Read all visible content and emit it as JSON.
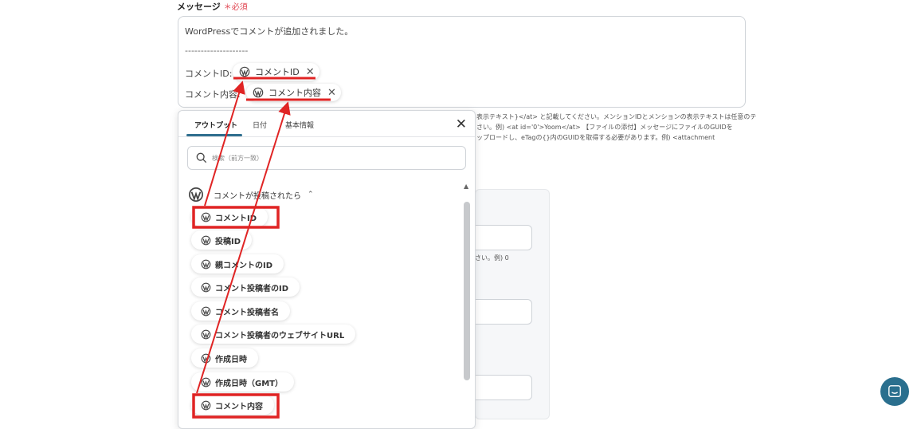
{
  "field": {
    "label": "メッセージ",
    "required": "＊必須"
  },
  "message": {
    "line1": "WordPressでコメントが追加されました。",
    "divider": "--------------------",
    "comment_id_label": "コメントID:",
    "comment_id_chip": "コメントID",
    "comment_content_label": "コメント内容:",
    "comment_content_chip": "コメント内容"
  },
  "help": {
    "line1": "表示テキスト}</at> と記載してください。メンションIDとメンションの表示テキストは任意のテ",
    "line2": "さい。例) <at id='0'>Yoom</at>  【ファイルの添付】メッセージにファイルのGUIDを",
    "line3": "ップロードし、eTagの{}内のGUIDを取得する必要があります。例) <attachment"
  },
  "background": {
    "hint": "さい。例) 0"
  },
  "popup": {
    "tabs": [
      "アウトプット",
      "日付",
      "基本情報"
    ],
    "search_placeholder": "検索（前方一致）",
    "group_label": "コメントが投稿されたら",
    "items": [
      "コメントID",
      "投稿ID",
      "親コメントのID",
      "コメント投稿者のID",
      "コメント投稿者名",
      "コメント投稿者のウェブサイトURL",
      "作成日時",
      "作成日時（GMT）",
      "コメント内容"
    ]
  },
  "colors": {
    "accent": "#2f6f8f",
    "annotation": "#e02424",
    "required": "#e0434f"
  },
  "icons": {
    "wordpress": "wordpress-icon",
    "close": "close-icon",
    "search": "search-icon",
    "chat": "chat-icon"
  }
}
